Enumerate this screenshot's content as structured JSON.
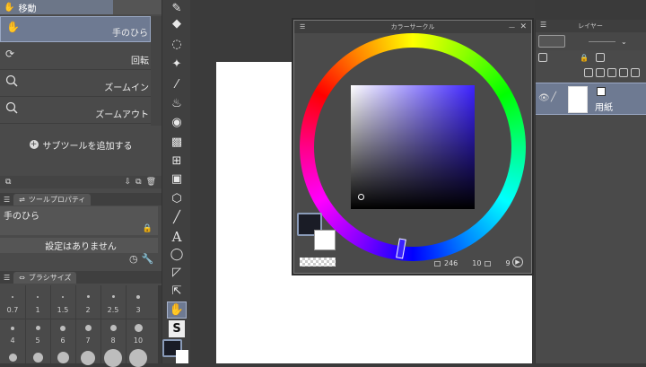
{
  "subtool": {
    "group_label": "移動",
    "items": [
      {
        "label": "手のひら",
        "icon": "hand-icon",
        "selected": true
      },
      {
        "label": "回転",
        "icon": "rotate-icon",
        "selected": false
      },
      {
        "label": "ズームイン",
        "icon": "zoom-in-icon",
        "selected": false
      },
      {
        "label": "ズームアウト",
        "icon": "zoom-out-icon",
        "selected": false
      }
    ],
    "add_label": "サブツールを追加する"
  },
  "tool_property": {
    "tab_label": "ツールプロパティ",
    "tool_name": "手のひら",
    "no_settings": "設定はありません"
  },
  "brush_size": {
    "tab_label": "ブラシサイズ",
    "row1": [
      "0.7",
      "1",
      "1.5",
      "2",
      "2.5",
      "3"
    ],
    "row2": [
      "4",
      "5",
      "6",
      "7",
      "8",
      "10"
    ]
  },
  "color_circle": {
    "title": "カラーサークル",
    "hue": 246,
    "sat": "10",
    "val": "9",
    "main_color": "#1a1c26",
    "sub_color": "#ffffff"
  },
  "layer_panel": {
    "title": "レイヤー",
    "layer_name": "用紙"
  },
  "colors": {
    "accent": "#6e7a92",
    "panel": "#4a4a4a"
  }
}
